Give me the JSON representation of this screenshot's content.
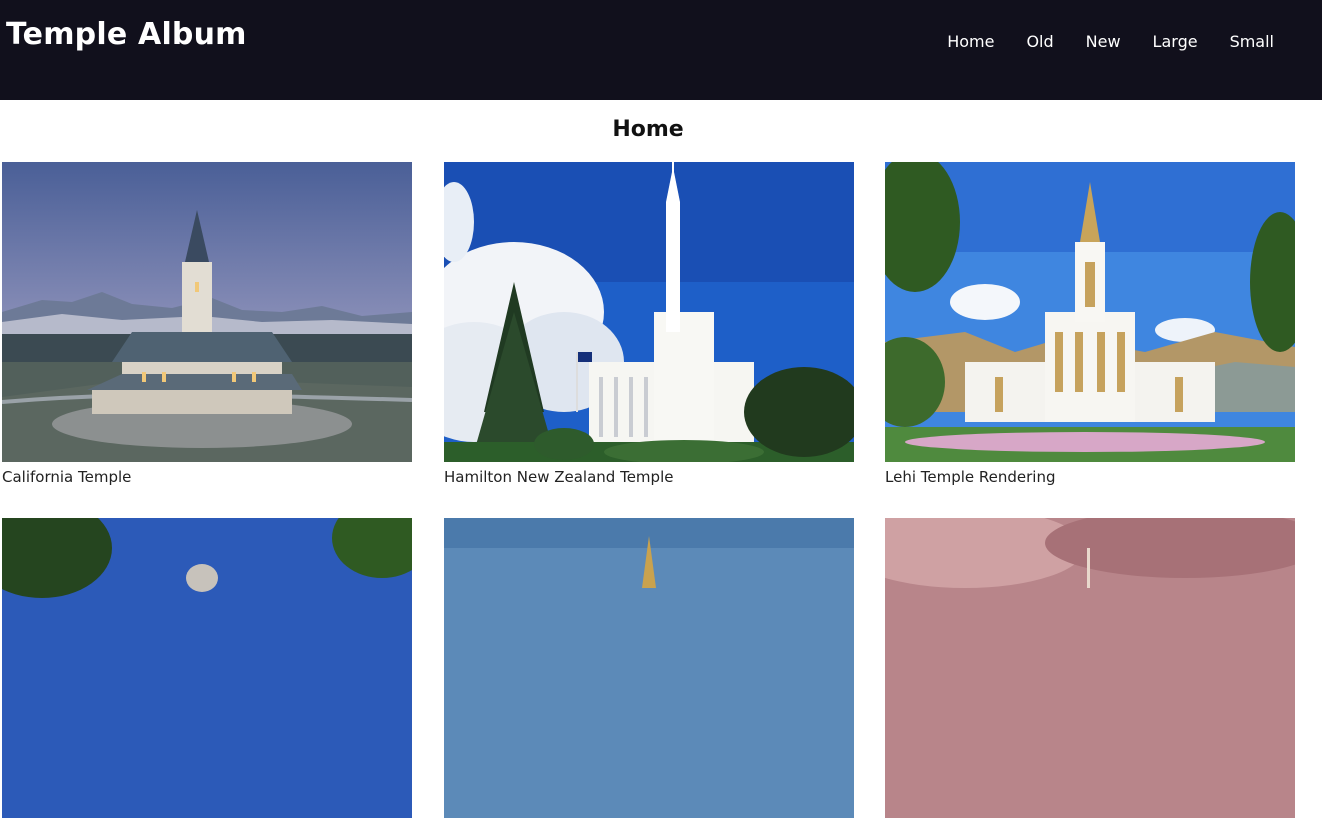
{
  "header": {
    "title": "Temple Album",
    "nav": [
      "Home",
      "Old",
      "New",
      "Large",
      "Small"
    ]
  },
  "main": {
    "heading": "Home",
    "cards": [
      {
        "caption": "California Temple"
      },
      {
        "caption": "Hamilton New Zealand Temple"
      },
      {
        "caption": "Lehi Temple Rendering"
      },
      {
        "caption": ""
      },
      {
        "caption": ""
      },
      {
        "caption": ""
      }
    ]
  },
  "colors": {
    "header_bg": "#11101c",
    "page_bg": "#ffffff",
    "text": "#111111"
  }
}
